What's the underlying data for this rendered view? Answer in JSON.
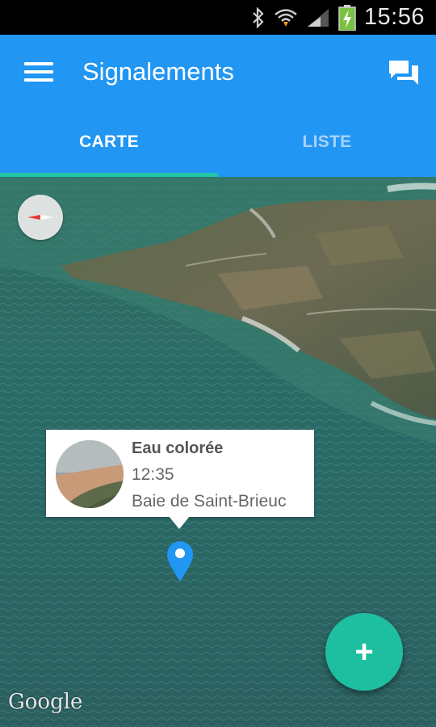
{
  "status_bar": {
    "time": "15:56",
    "icons": [
      "bluetooth-icon",
      "wifi-icon",
      "signal-icon",
      "battery-charging-icon"
    ]
  },
  "app_bar": {
    "title": "Signalements",
    "left_icon": "menu-icon",
    "right_icon": "chat-icon",
    "color": "#2196f3"
  },
  "tabs": [
    {
      "label": "CARTE",
      "active": true
    },
    {
      "label": "LISTE",
      "active": false
    }
  ],
  "accent_color": "#22c4a6",
  "map": {
    "info_window": {
      "title": "Eau colorée",
      "time": "12:35",
      "place": "Baie de Saint-Brieuc"
    },
    "attribution": "Google",
    "fab_symbol": "+"
  }
}
